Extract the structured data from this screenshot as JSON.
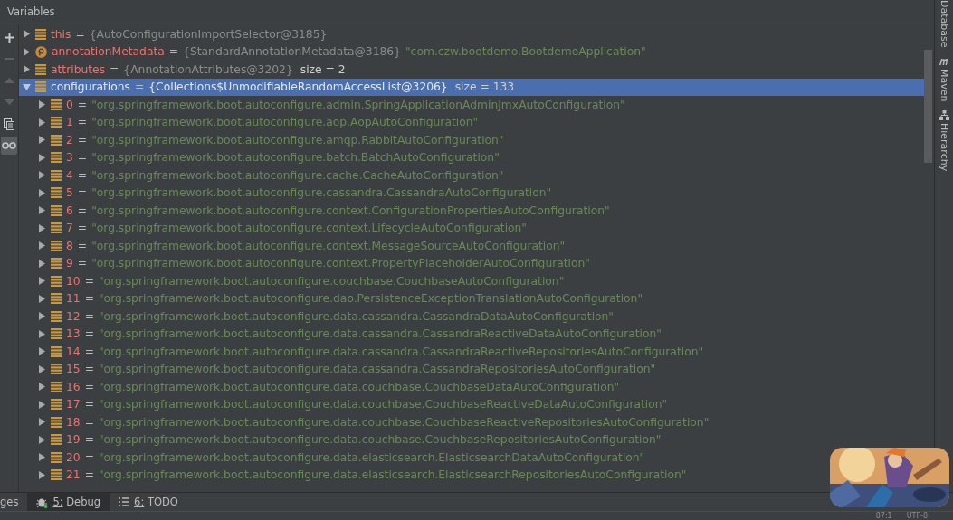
{
  "panel": {
    "title": "Variables"
  },
  "toolbar": [
    {
      "kind": "plus",
      "disabled": false,
      "selected": false
    },
    {
      "kind": "minus",
      "disabled": true,
      "selected": false
    },
    {
      "kind": "up",
      "disabled": true,
      "selected": false
    },
    {
      "kind": "down",
      "disabled": true,
      "selected": false
    },
    {
      "kind": "copy",
      "disabled": false,
      "selected": false
    },
    {
      "kind": "glasses",
      "disabled": false,
      "selected": true
    }
  ],
  "variables": [
    {
      "kind": "field",
      "name": "this",
      "sep": "=",
      "type": "{AutoConfigurationImportSelector@3185}",
      "expanded": false,
      "selected": false
    },
    {
      "kind": "protected",
      "name": "annotationMetadata",
      "sep": "=",
      "type": "{StandardAnnotationMetadata@3186}",
      "value": "\"com.czw.bootdemo.BootdemoApplication\"",
      "expanded": false,
      "selected": false
    },
    {
      "kind": "field",
      "name": "attributes",
      "sep": "=",
      "type": "{AnnotationAttributes@3202}",
      "value": "size = 2",
      "expanded": false,
      "selected": false
    },
    {
      "kind": "field",
      "name": "configurations",
      "sep": "=",
      "type": "{Collections$UnmodifiableRandomAccessList@3206}",
      "value": "size = 133",
      "expanded": true,
      "selected": true,
      "children": [
        {
          "name": "0",
          "sep": "=",
          "value": "\"org.springframework.boot.autoconfigure.admin.SpringApplicationAdminJmxAutoConfiguration\""
        },
        {
          "name": "1",
          "sep": "=",
          "value": "\"org.springframework.boot.autoconfigure.aop.AopAutoConfiguration\""
        },
        {
          "name": "2",
          "sep": "=",
          "value": "\"org.springframework.boot.autoconfigure.amqp.RabbitAutoConfiguration\""
        },
        {
          "name": "3",
          "sep": "=",
          "value": "\"org.springframework.boot.autoconfigure.batch.BatchAutoConfiguration\""
        },
        {
          "name": "4",
          "sep": "=",
          "value": "\"org.springframework.boot.autoconfigure.cache.CacheAutoConfiguration\""
        },
        {
          "name": "5",
          "sep": "=",
          "value": "\"org.springframework.boot.autoconfigure.cassandra.CassandraAutoConfiguration\""
        },
        {
          "name": "6",
          "sep": "=",
          "value": "\"org.springframework.boot.autoconfigure.context.ConfigurationPropertiesAutoConfiguration\""
        },
        {
          "name": "7",
          "sep": "=",
          "value": "\"org.springframework.boot.autoconfigure.context.LifecycleAutoConfiguration\""
        },
        {
          "name": "8",
          "sep": "=",
          "value": "\"org.springframework.boot.autoconfigure.context.MessageSourceAutoConfiguration\""
        },
        {
          "name": "9",
          "sep": "=",
          "value": "\"org.springframework.boot.autoconfigure.context.PropertyPlaceholderAutoConfiguration\""
        },
        {
          "name": "10",
          "sep": "=",
          "value": "\"org.springframework.boot.autoconfigure.couchbase.CouchbaseAutoConfiguration\""
        },
        {
          "name": "11",
          "sep": "=",
          "value": "\"org.springframework.boot.autoconfigure.dao.PersistenceExceptionTranslationAutoConfiguration\""
        },
        {
          "name": "12",
          "sep": "=",
          "value": "\"org.springframework.boot.autoconfigure.data.cassandra.CassandraDataAutoConfiguration\""
        },
        {
          "name": "13",
          "sep": "=",
          "value": "\"org.springframework.boot.autoconfigure.data.cassandra.CassandraReactiveDataAutoConfiguration\""
        },
        {
          "name": "14",
          "sep": "=",
          "value": "\"org.springframework.boot.autoconfigure.data.cassandra.CassandraReactiveRepositoriesAutoConfiguration\""
        },
        {
          "name": "15",
          "sep": "=",
          "value": "\"org.springframework.boot.autoconfigure.data.cassandra.CassandraRepositoriesAutoConfiguration\""
        },
        {
          "name": "16",
          "sep": "=",
          "value": "\"org.springframework.boot.autoconfigure.data.couchbase.CouchbaseDataAutoConfiguration\""
        },
        {
          "name": "17",
          "sep": "=",
          "value": "\"org.springframework.boot.autoconfigure.data.couchbase.CouchbaseReactiveDataAutoConfiguration\""
        },
        {
          "name": "18",
          "sep": "=",
          "value": "\"org.springframework.boot.autoconfigure.data.couchbase.CouchbaseReactiveRepositoriesAutoConfiguration\""
        },
        {
          "name": "19",
          "sep": "=",
          "value": "\"org.springframework.boot.autoconfigure.data.couchbase.CouchbaseRepositoriesAutoConfiguration\""
        },
        {
          "name": "20",
          "sep": "=",
          "value": "\"org.springframework.boot.autoconfigure.data.elasticsearch.ElasticsearchDataAutoConfiguration\""
        },
        {
          "name": "21",
          "sep": "=",
          "value": "\"org.springframework.boot.autoconfigure.data.elasticsearch.ElasticsearchRepositoriesAutoConfiguration\""
        }
      ]
    }
  ],
  "side_tools": [
    {
      "kind": "database",
      "label": "Database"
    },
    {
      "kind": "maven",
      "label": "Maven"
    },
    {
      "kind": "hierarchy",
      "label": "Hierarchy"
    }
  ],
  "bottom_tabs": [
    {
      "kind": "plain",
      "label": "ges",
      "selected": false
    },
    {
      "kind": "debug",
      "label": "5: Debug",
      "selected": true
    },
    {
      "kind": "todo",
      "label": "6: TODO",
      "selected": false
    }
  ],
  "status_bar": {
    "position": "87:1",
    "encoding": "UTF-8"
  }
}
